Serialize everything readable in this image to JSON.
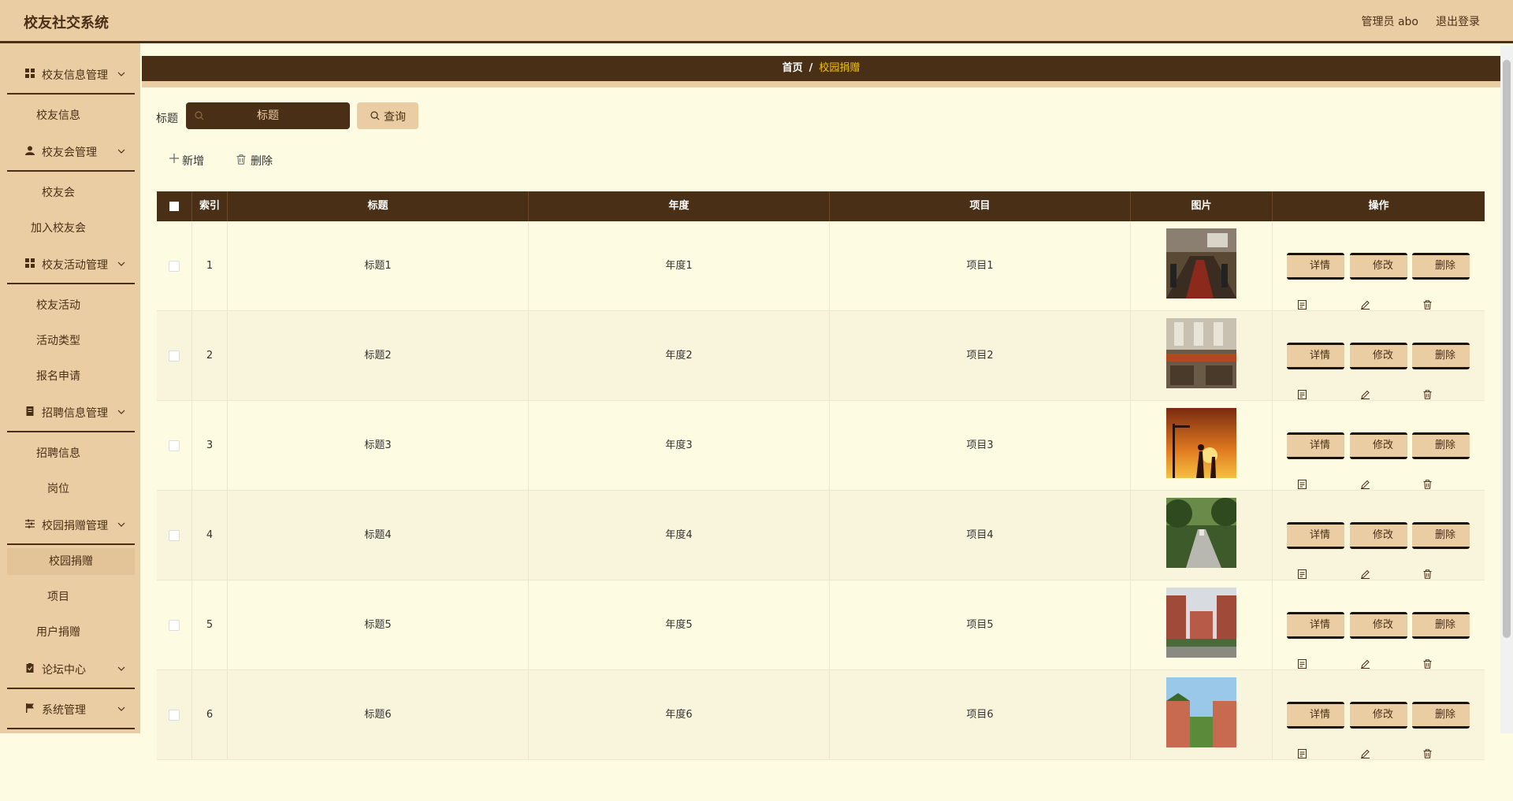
{
  "header": {
    "title": "校友社交系统",
    "admin": "管理员 abo",
    "logout": "退出登录"
  },
  "sidebar": {
    "groups": [
      {
        "label": "校友信息管理",
        "icon": "grid-icon",
        "items": [
          "校友信息"
        ]
      },
      {
        "label": "校友会管理",
        "icon": "user-icon",
        "items": [
          "校友会",
          "加入校友会"
        ]
      },
      {
        "label": "校友活动管理",
        "icon": "grid-icon",
        "items": [
          "校友活动",
          "活动类型",
          "报名申请"
        ]
      },
      {
        "label": "招聘信息管理",
        "icon": "document-icon",
        "items": [
          "招聘信息",
          "岗位"
        ]
      },
      {
        "label": "校园捐赠管理",
        "icon": "sliders-icon",
        "items": [
          "校园捐赠",
          "项目",
          "用户捐赠"
        ]
      },
      {
        "label": "论坛中心",
        "icon": "clipboard-icon",
        "items": []
      },
      {
        "label": "系统管理",
        "icon": "flag-icon",
        "items": []
      }
    ],
    "active_item": "校园捐赠"
  },
  "breadcrumb": {
    "home": "首页",
    "separator": "/",
    "current": "校园捐赠"
  },
  "search": {
    "label": "标题",
    "placeholder": "标题",
    "button": "查询"
  },
  "toolbar": {
    "add": "新增",
    "delete": "删除"
  },
  "table": {
    "headers": [
      "索引",
      "标题",
      "年度",
      "项目",
      "图片",
      "操作"
    ],
    "rows": [
      {
        "index": "1",
        "title": "标题1",
        "year": "年度1",
        "project": "项目1"
      },
      {
        "index": "2",
        "title": "标题2",
        "year": "年度2",
        "project": "项目2"
      },
      {
        "index": "3",
        "title": "标题3",
        "year": "年度3",
        "project": "项目3"
      },
      {
        "index": "4",
        "title": "标题4",
        "year": "年度4",
        "project": "项目4"
      },
      {
        "index": "5",
        "title": "标题5",
        "year": "年度5",
        "project": "项目5"
      },
      {
        "index": "6",
        "title": "标题6",
        "year": "年度6",
        "project": "项目6"
      }
    ],
    "actions": {
      "detail": "详情",
      "edit": "修改",
      "delete": "删除"
    }
  },
  "colors": {
    "header_bg": "#ebcda3",
    "dark_brown": "#4a2f17",
    "content_bg": "#fdfbe2",
    "breadcrumb_active": "#f5c400"
  }
}
